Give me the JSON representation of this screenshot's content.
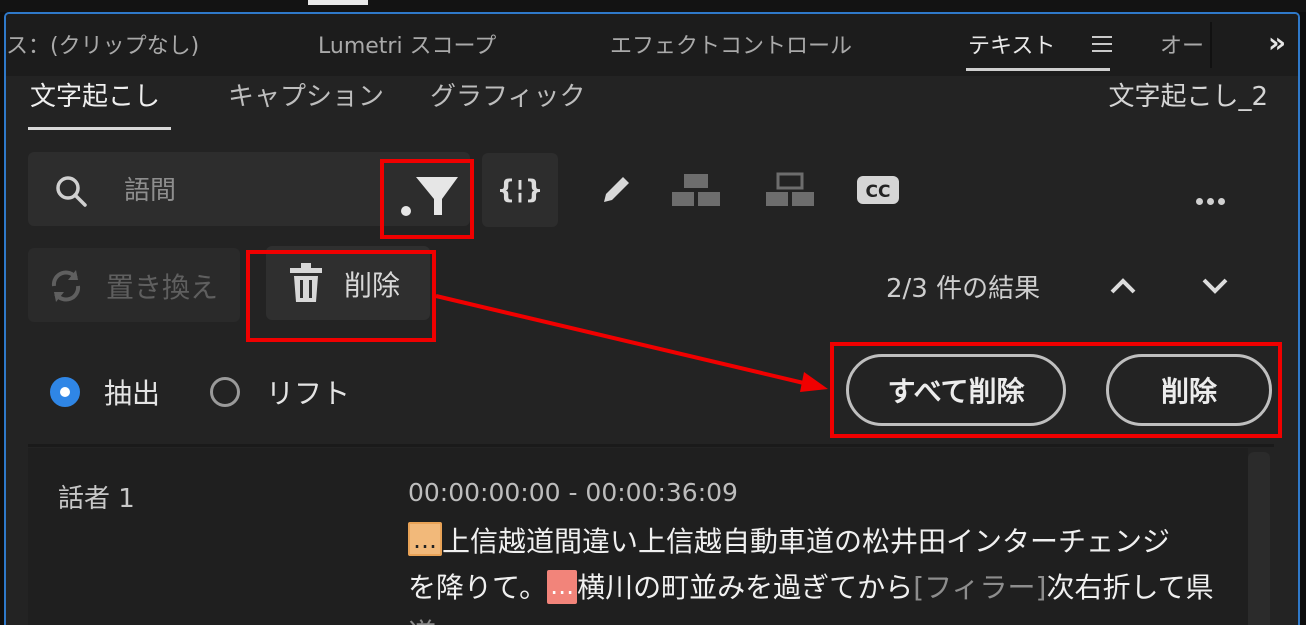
{
  "panel_tabs": [
    {
      "label": "ス：(クリップなし)"
    },
    {
      "label": "Lumetri スコープ"
    },
    {
      "label": "エフェクトコントロール"
    },
    {
      "label": "テキスト"
    },
    {
      "label": "オー"
    }
  ],
  "sub_tabs": [
    {
      "label": "文字起こし"
    },
    {
      "label": "キャプション"
    },
    {
      "label": "グラフィック"
    }
  ],
  "document_name": "文字起こし_2",
  "search": {
    "value": "語間",
    "placeholder": ""
  },
  "toolbar": {
    "icons": [
      "filter-icon",
      "braces-icon",
      "pencil-icon",
      "merge-segments-icon",
      "split-segments-icon",
      "cc-icon",
      "more-icon"
    ]
  },
  "actions": {
    "replace_label": "置き換え",
    "delete_label": "削除",
    "results": "2/3 件の結果"
  },
  "radios": {
    "extract_label": "抽出",
    "lift_label": "リフト",
    "selected": "extract"
  },
  "buttons": {
    "delete_all": "すべて削除",
    "delete": "削除"
  },
  "transcript": {
    "speaker": "話者 1",
    "timecode": "00:00:00:00 - 00:00:36:09",
    "gap_marker": "…",
    "line1_text": "上信越道間違い上信越自動車道の松井田インターチェンジ",
    "line2_a": "を降りて。",
    "line2_b": "横川の町並みを過ぎてから",
    "line2_filler": "[フィラー]",
    "line2_c": "次右折して県"
  },
  "colors": {
    "accent_blue": "#2f86e6",
    "annotation_red": "#f00000",
    "gap_orange": "#f2b97a",
    "gap_pink": "#f2847a"
  }
}
